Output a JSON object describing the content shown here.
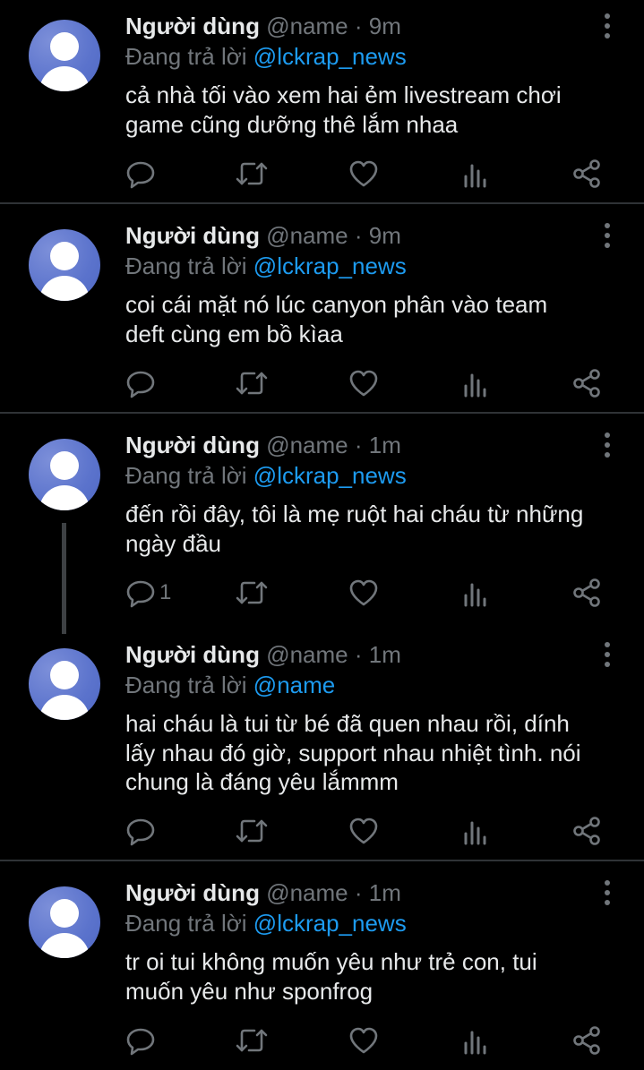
{
  "colors": {
    "background": "#000000",
    "text": "#e7e9ea",
    "muted": "#71767b",
    "mention": "#1d9bf0",
    "divider": "#2f3336",
    "avatar": "#5b73cc"
  },
  "icons": [
    "more-icon",
    "reply-icon",
    "retweet-icon",
    "like-icon",
    "views-icon",
    "share-icon"
  ],
  "tweets": [
    {
      "display_name": "Người dùng",
      "handle": "@name",
      "separator": "·",
      "time": "9m",
      "replying_label": "Đang trả lời",
      "replying_to": "@lckrap_news",
      "lines": [
        "cả nhà tối vào xem hai ẻm livestream chơi",
        "game cũng dưỡng thê lắm nhaa"
      ],
      "reply_count": ""
    },
    {
      "display_name": "Người dùng",
      "handle": "@name",
      "separator": "·",
      "time": "9m",
      "replying_label": "Đang trả lời",
      "replying_to": "@lckrap_news",
      "lines": [
        "coi cái mặt nó lúc canyon phân vào team",
        "deft cùng em bồ kìaa"
      ],
      "reply_count": ""
    },
    {
      "display_name": "Người dùng",
      "handle": "@name",
      "separator": "·",
      "time": "1m",
      "replying_label": "Đang trả lời",
      "replying_to": "@lckrap_news",
      "lines": [
        "đến rồi đây, tôi là mẹ ruột hai cháu từ những",
        "ngày đầu"
      ],
      "reply_count": "1"
    },
    {
      "display_name": "Người dùng",
      "handle": "@name",
      "separator": "·",
      "time": "1m",
      "replying_label": "Đang trả lời",
      "replying_to": "@name",
      "lines": [
        "hai cháu là tui từ bé đã quen nhau rồi, dính",
        "lấy nhau đó giờ, support nhau nhiệt tình. nói",
        "chung là đáng yêu lắmmm"
      ],
      "reply_count": ""
    },
    {
      "display_name": "Người dùng",
      "handle": "@name",
      "separator": "·",
      "time": "1m",
      "replying_label": "Đang trả lời",
      "replying_to": "@lckrap_news",
      "lines": [
        "tr oi tui không muốn yêu như trẻ con, tui",
        "muốn yêu như sponfrog"
      ],
      "reply_count": ""
    }
  ]
}
